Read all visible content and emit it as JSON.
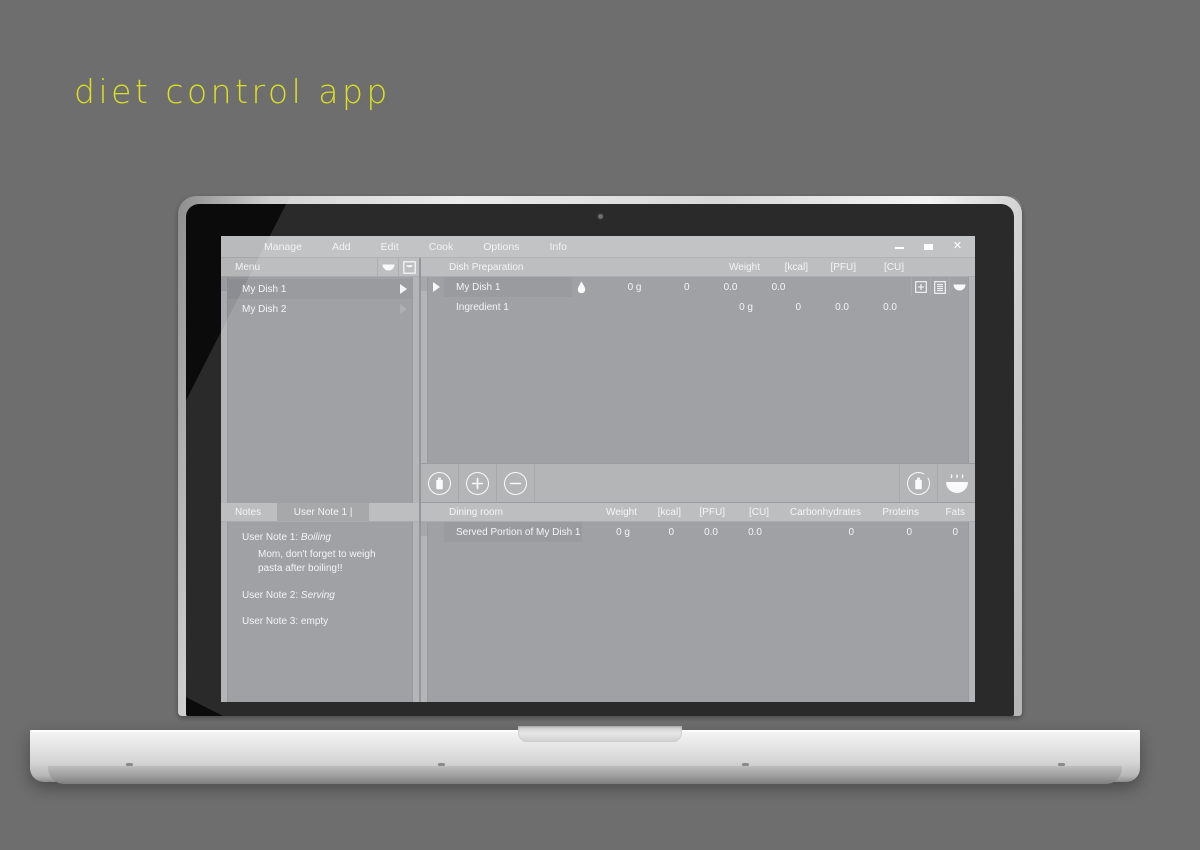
{
  "page": {
    "title": "diet control app",
    "title_color": "#d9e021",
    "background_color": "#6e6e6e"
  },
  "app": {
    "menubar": {
      "items": [
        {
          "label": "Manage"
        },
        {
          "label": "Add"
        },
        {
          "label": "Edit"
        },
        {
          "label": "Cook"
        },
        {
          "label": "Options"
        },
        {
          "label": "Info"
        }
      ],
      "window_controls": [
        {
          "name": "minimize",
          "glyph": "–"
        },
        {
          "name": "maximize",
          "glyph": "▬"
        },
        {
          "name": "close",
          "glyph": "✕"
        }
      ]
    },
    "menu_panel": {
      "header": "Menu",
      "header_icons": [
        "bowl-icon",
        "pot-icon"
      ],
      "items": [
        {
          "label": "My Dish 1",
          "selected": true
        },
        {
          "label": "My Dish 2",
          "selected": false
        }
      ]
    },
    "notes_panel": {
      "label": "Notes",
      "active_tab": "User Note 1 |",
      "notes": [
        {
          "title": "User Note 1:",
          "kind": "Boiling",
          "text": "Mom, don't forget to weigh pasta after boiling!!"
        },
        {
          "title": "User Note 2:",
          "kind": "Serving",
          "text": ""
        },
        {
          "title": "User Note 3:",
          "kind": "empty",
          "text": ""
        }
      ]
    },
    "dish_preparation": {
      "columns": [
        "Dish Preparation",
        "Weight",
        "[kcal]",
        "[PFU]",
        "[CU]"
      ],
      "rows": [
        {
          "name": "My Dish 1",
          "weight": "0 g",
          "kcal": "0",
          "pfu": "0.0",
          "cu": "0.0",
          "selected": true,
          "has_droplet": true,
          "icons": [
            "add-box-icon",
            "list-icon",
            "bowl-icon"
          ]
        },
        {
          "name": "Ingredient 1",
          "weight": "0 g",
          "kcal": "0",
          "pfu": "0.0",
          "cu": "0.0",
          "selected": false,
          "has_droplet": false,
          "icons": []
        }
      ]
    },
    "toolbar": {
      "left_buttons": [
        "jar-circle-icon",
        "plus-circle-icon",
        "minus-circle-icon"
      ],
      "right_buttons": [
        "jar-bite-icon",
        "steaming-bowl-icon"
      ]
    },
    "dining_room": {
      "columns": [
        "Dining room",
        "Weight",
        "[kcal]",
        "[PFU]",
        "[CU]",
        "Carbonhydrates",
        "Proteins",
        "Fats"
      ],
      "rows": [
        {
          "name": "Served Portion of My Dish 1",
          "weight": "0 g",
          "kcal": "0",
          "pfu": "0.0",
          "cu": "0.0",
          "carbs": "0",
          "proteins": "0",
          "fats": "0"
        }
      ]
    }
  }
}
